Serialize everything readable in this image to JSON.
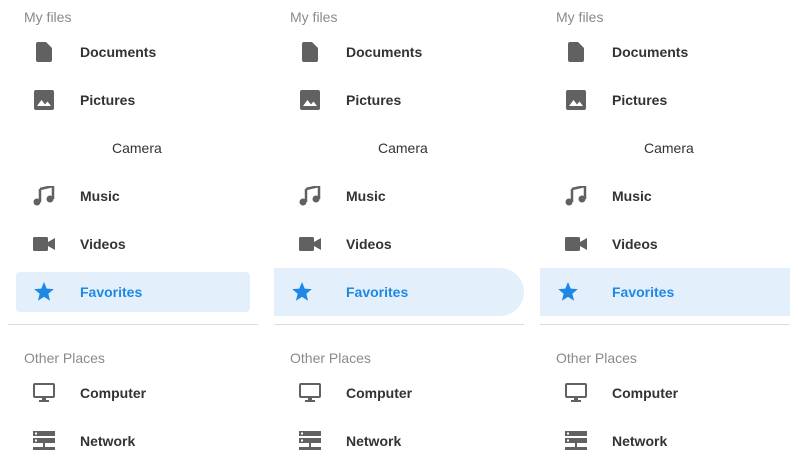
{
  "colors": {
    "accent": "#1e88e5",
    "selected_bg": "#e3f0fb",
    "icon": "#616161",
    "section_title": "#8a8a8a",
    "text": "#333333",
    "divider": "#dcdcdc"
  },
  "panels": [
    {
      "my_files_title": "My files",
      "items": [
        {
          "label": "Documents",
          "icon": "document-icon"
        },
        {
          "label": "Pictures",
          "icon": "image-icon"
        },
        {
          "label": "Camera",
          "icon": ""
        },
        {
          "label": "Music",
          "icon": "music-note-icon"
        },
        {
          "label": "Videos",
          "icon": "video-camera-icon"
        },
        {
          "label": "Favorites",
          "icon": "star-icon",
          "selected": true
        }
      ],
      "other_places_title": "Other Places",
      "other_items": [
        {
          "label": "Computer",
          "icon": "monitor-icon"
        },
        {
          "label": "Network",
          "icon": "server-icon"
        }
      ]
    },
    {
      "my_files_title": "My files",
      "items": [
        {
          "label": "Documents",
          "icon": "document-icon"
        },
        {
          "label": "Pictures",
          "icon": "image-icon"
        },
        {
          "label": "Camera",
          "icon": ""
        },
        {
          "label": "Music",
          "icon": "music-note-icon"
        },
        {
          "label": "Videos",
          "icon": "video-camera-icon"
        },
        {
          "label": "Favorites",
          "icon": "star-icon",
          "selected": true
        }
      ],
      "other_places_title": "Other Places",
      "other_items": [
        {
          "label": "Computer",
          "icon": "monitor-icon"
        },
        {
          "label": "Network",
          "icon": "server-icon"
        }
      ]
    },
    {
      "my_files_title": "My files",
      "items": [
        {
          "label": "Documents",
          "icon": "document-icon"
        },
        {
          "label": "Pictures",
          "icon": "image-icon"
        },
        {
          "label": "Camera",
          "icon": ""
        },
        {
          "label": "Music",
          "icon": "music-note-icon"
        },
        {
          "label": "Videos",
          "icon": "video-camera-icon"
        },
        {
          "label": "Favorites",
          "icon": "star-icon",
          "selected": true
        }
      ],
      "other_places_title": "Other Places",
      "other_items": [
        {
          "label": "Computer",
          "icon": "monitor-icon"
        },
        {
          "label": "Network",
          "icon": "server-icon"
        }
      ]
    }
  ]
}
